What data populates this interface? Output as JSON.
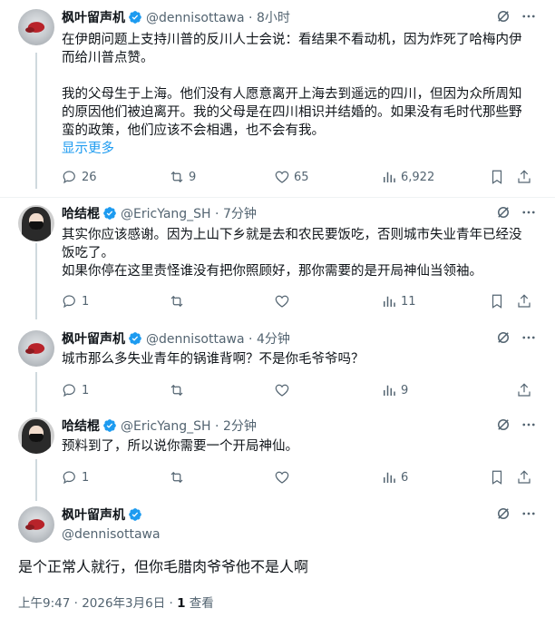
{
  "tweets": [
    {
      "name": "枫叶留声机",
      "handle": "@dennisottawa",
      "dot": "·",
      "time": "8小时",
      "paragraphs": [
        "在伊朗问题上支持川普的反川人士会说：看结果不看动机，因为炸死了哈梅内伊而给川普点赞。",
        "我的父母生于上海。他们没有人愿意离开上海去到遥远的四川，但因为众所周知的原因他们被迫离开。我的父母是在四川相识并结婚的。如果没有毛时代那些野蛮的政策，他们应该不会相遇，也不会有我。"
      ],
      "show_more": "显示更多",
      "replies": "26",
      "retweets": "9",
      "likes": "65",
      "views": "6,922"
    },
    {
      "name": "哈结棍",
      "handle": "@EricYang_SH",
      "dot": "·",
      "time": "7分钟",
      "paragraphs": [
        "其实你应该感谢。因为上山下乡就是去和农民要饭吃，否则城市失业青年已经没饭吃了。",
        "如果你停在这里责怪谁没有把你照顾好，那你需要的是开局神仙当领袖。"
      ],
      "replies": "1",
      "retweets": "",
      "likes": "",
      "views": "11"
    },
    {
      "name": "枫叶留声机",
      "handle": "@dennisottawa",
      "dot": "·",
      "time": "4分钟",
      "paragraphs": [
        "城市那么多失业青年的锅谁背啊？不是你毛爷爷吗？"
      ],
      "replies": "1",
      "retweets": "",
      "likes": "",
      "views": "9"
    },
    {
      "name": "哈结棍",
      "handle": "@EricYang_SH",
      "dot": "·",
      "time": "2分钟",
      "paragraphs": [
        "预料到了，所以说你需要一个开局神仙。"
      ],
      "replies": "1",
      "retweets": "",
      "likes": "",
      "views": "6"
    }
  ],
  "focused": {
    "name": "枫叶留声机",
    "handle": "@dennisottawa",
    "text": "是个正常人就行，但你毛腊肉爷爷他不是人啊",
    "timestamp": "上午9:47 · 2026年3月6日 · ",
    "view_count": "1",
    "view_label": " 查看"
  },
  "icons": {
    "grok": "grok-icon",
    "more": "more-icon",
    "reply": "reply-icon",
    "retweet": "retweet-icon",
    "like": "like-icon",
    "views": "views-icon",
    "bookmark": "bookmark-icon",
    "share": "share-icon",
    "verified": "verified-badge-icon"
  },
  "colors": {
    "accent": "#1d9bf0",
    "muted": "#536471",
    "text": "#0f1419",
    "line": "#cfd9de"
  }
}
